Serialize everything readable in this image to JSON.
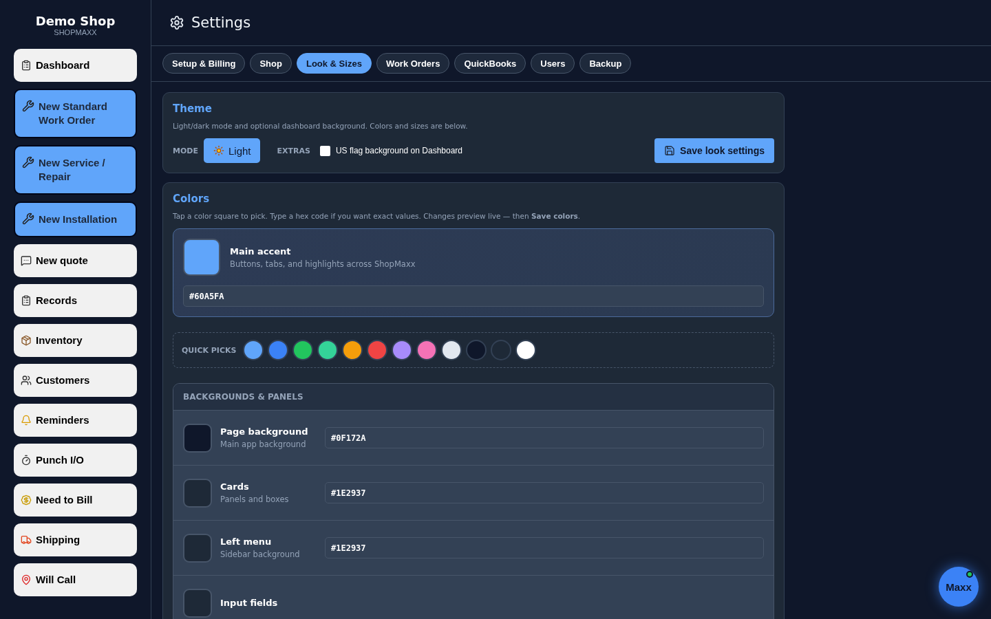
{
  "sidebar": {
    "shop_name": "Demo Shop",
    "brand": "SHOPMAXX",
    "items": [
      {
        "label": "Dashboard",
        "kind": "nav"
      },
      {
        "label": "New Standard Work Order",
        "kind": "action"
      },
      {
        "label": "New Service / Repair",
        "kind": "action"
      },
      {
        "label": "New Installation",
        "kind": "action"
      },
      {
        "label": "New quote",
        "kind": "nav"
      },
      {
        "label": "Records",
        "kind": "nav"
      },
      {
        "label": "Inventory",
        "kind": "nav"
      },
      {
        "label": "Customers",
        "kind": "nav"
      },
      {
        "label": "Reminders",
        "kind": "nav"
      },
      {
        "label": "Punch I/O",
        "kind": "nav"
      },
      {
        "label": "Need to Bill",
        "kind": "nav"
      },
      {
        "label": "Shipping",
        "kind": "nav"
      },
      {
        "label": "Will Call",
        "kind": "nav"
      }
    ]
  },
  "header": {
    "title": "Settings"
  },
  "tabs": [
    {
      "label": "Setup & Billing",
      "selected": false
    },
    {
      "label": "Shop",
      "selected": false
    },
    {
      "label": "Look & Sizes",
      "selected": true
    },
    {
      "label": "Work Orders",
      "selected": false
    },
    {
      "label": "QuickBooks",
      "selected": false
    },
    {
      "label": "Users",
      "selected": false
    },
    {
      "label": "Backup",
      "selected": false
    }
  ],
  "theme": {
    "title": "Theme",
    "description": "Light/dark mode and optional dashboard background. Colors and sizes are below.",
    "mode_label": "MODE",
    "mode_button": "Light",
    "extras_label": "EXTRAS",
    "flag_option": {
      "label": "US flag background on Dashboard",
      "checked": false
    },
    "save_button": "Save look settings"
  },
  "colors": {
    "title": "Colors",
    "description": "Tap a color square to pick. Type a hex code if you want exact values. Changes preview live — then **Save colors**.",
    "main_accent": {
      "name": "Main accent",
      "description": "Buttons, tabs, and highlights across ShopMaxx",
      "value": "#60A5FA",
      "color": "#60a5fa"
    },
    "quick_picks": {
      "label": "QUICK PICKS",
      "swatches": [
        {
          "color": "#60a5fa"
        },
        {
          "color": "#3b82f6"
        },
        {
          "color": "#22c55e"
        },
        {
          "color": "#34d399"
        },
        {
          "color": "#f59e0b"
        },
        {
          "color": "#ef4444"
        },
        {
          "color": "#a78bfa"
        },
        {
          "color": "#f472b6"
        },
        {
          "color": "#e2e8f0"
        },
        {
          "color": "#0f172a"
        },
        {
          "color": "#1e2937"
        },
        {
          "color": "#ffffff"
        }
      ]
    },
    "backgrounds": {
      "title": "BACKGROUNDS & PANELS",
      "rows": [
        {
          "name": "Page background",
          "description": "Main app background",
          "value": "#0F172A",
          "color": "#0f172a"
        },
        {
          "name": "Cards",
          "description": "Panels and boxes",
          "value": "#1E2937",
          "color": "#1e2937"
        },
        {
          "name": "Left menu",
          "description": "Sidebar background",
          "value": "#1E2937",
          "color": "#1e2937"
        },
        {
          "name": "Input fields",
          "color": "#1e2937"
        }
      ]
    }
  },
  "assistant": {
    "label": "Maxx",
    "online": true
  }
}
